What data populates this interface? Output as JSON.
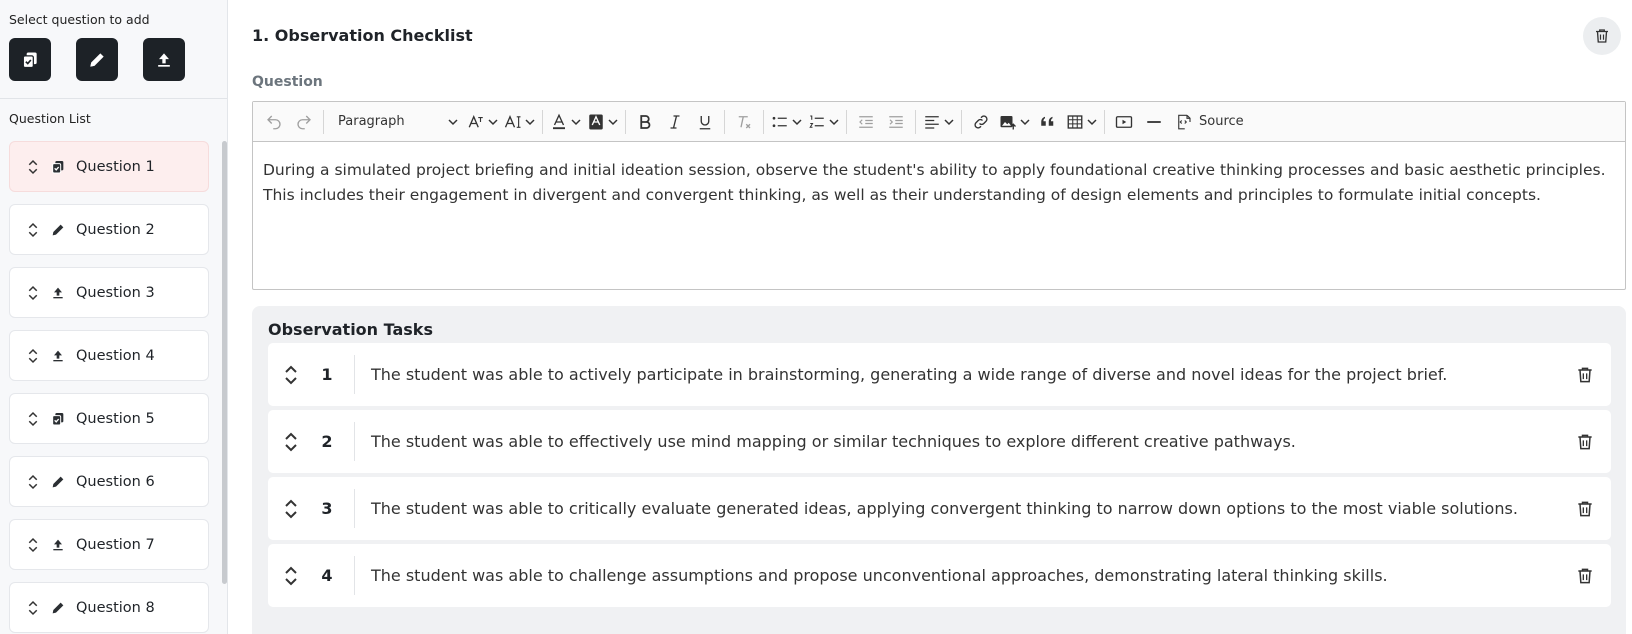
{
  "sidebar": {
    "select_label": "Select question to add",
    "question_types": [
      {
        "icon": "copy-check-icon"
      },
      {
        "icon": "pencil-icon"
      },
      {
        "icon": "upload-icon"
      }
    ],
    "list_label": "Question List",
    "questions": [
      {
        "label": "Question 1",
        "type_icon": "copy-check-icon",
        "active": true
      },
      {
        "label": "Question 2",
        "type_icon": "pencil-icon",
        "active": false
      },
      {
        "label": "Question 3",
        "type_icon": "upload-icon",
        "active": false
      },
      {
        "label": "Question 4",
        "type_icon": "upload-icon",
        "active": false
      },
      {
        "label": "Question 5",
        "type_icon": "copy-check-icon",
        "active": false
      },
      {
        "label": "Question 6",
        "type_icon": "pencil-icon",
        "active": false
      },
      {
        "label": "Question 7",
        "type_icon": "upload-icon",
        "active": false
      },
      {
        "label": "Question 8",
        "type_icon": "pencil-icon",
        "active": false
      }
    ]
  },
  "main": {
    "title": "1. Observation Checklist",
    "question_label": "Question",
    "editor": {
      "paragraph_style": "Paragraph",
      "source_label": "Source",
      "content": "During a simulated project briefing and initial ideation session, observe the student's ability to apply foundational creative thinking processes and basic aesthetic principles. This includes their engagement in divergent and convergent thinking, as well as their understanding of design elements and principles to formulate initial concepts."
    },
    "tasks_title": "Observation Tasks",
    "tasks": [
      {
        "number": "1",
        "text": "The student was able to actively participate in brainstorming, generating a wide range of diverse and novel ideas for the project brief."
      },
      {
        "number": "2",
        "text": "The student was able to effectively use mind mapping or similar techniques to explore different creative pathways."
      },
      {
        "number": "3",
        "text": "The student was able to critically evaluate generated ideas, applying convergent thinking to narrow down options to the most viable solutions."
      },
      {
        "number": "4",
        "text": "The student was able to challenge assumptions and propose unconventional approaches, demonstrating lateral thinking skills."
      }
    ]
  },
  "colors": {
    "dark_button": "#1d2227",
    "active_item_bg": "#fdeeee",
    "panel_bg": "#f0f1f3"
  }
}
